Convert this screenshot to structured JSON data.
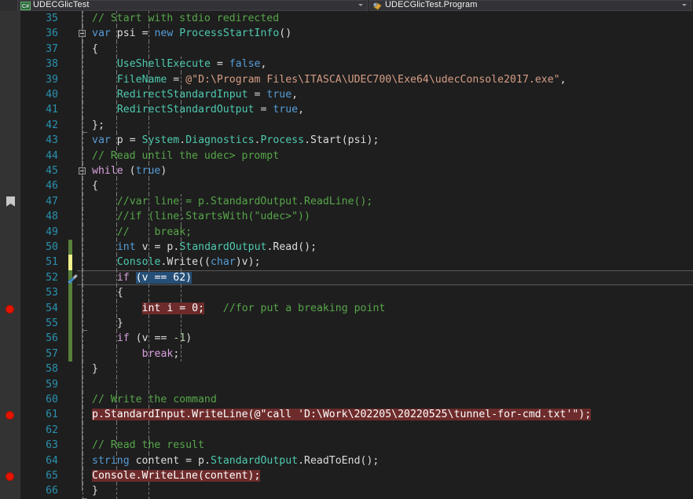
{
  "nav_bar": {
    "project_combo": {
      "icon": "csharp-file-icon",
      "label": "UDECGlicTest",
      "arrow": "chevron-down-icon"
    },
    "member_combo": {
      "icon": "class-member-icon",
      "label": "UDECGlicTest.Program",
      "arrow": "chevron-down-icon"
    }
  },
  "editor": {
    "language": "csharp",
    "theme": "dark",
    "first_line": 35,
    "last_line": 66,
    "current_line": 52,
    "selection_text": "(v == 62)",
    "breakpoint_lines": [
      54,
      61,
      65
    ],
    "bookmark_lines": [
      47
    ],
    "tool_icon_line": 52,
    "changed_saved_lines": [
      50,
      52,
      53,
      54,
      55,
      56,
      57
    ],
    "changed_unsaved_lines": [
      51
    ],
    "lines": [
      {
        "n": 35,
        "text": "// Start with stdio redirected"
      },
      {
        "n": 36,
        "text": "var psi = new ProcessStartInfo()"
      },
      {
        "n": 37,
        "text": "{"
      },
      {
        "n": 38,
        "text": "    UseShellExecute = false,"
      },
      {
        "n": 39,
        "text": "    FileName = @\"D:\\Program Files\\ITASCA\\UDEC700\\Exe64\\udecConsole2017.exe\","
      },
      {
        "n": 40,
        "text": "    RedirectStandardInput = true,"
      },
      {
        "n": 41,
        "text": "    RedirectStandardOutput = true,"
      },
      {
        "n": 42,
        "text": "};"
      },
      {
        "n": 43,
        "text": "var p = System.Diagnostics.Process.Start(psi);"
      },
      {
        "n": 44,
        "text": "// Read until the udec> prompt"
      },
      {
        "n": 45,
        "text": "while (true)"
      },
      {
        "n": 46,
        "text": "{"
      },
      {
        "n": 47,
        "text": "    //var line = p.StandardOutput.ReadLine();"
      },
      {
        "n": 48,
        "text": "    //if (line.StartsWith(\"udec>\"))"
      },
      {
        "n": 49,
        "text": "    //    break;"
      },
      {
        "n": 50,
        "text": "    int v = p.StandardOutput.Read();"
      },
      {
        "n": 51,
        "text": "    Console.Write((char)v);"
      },
      {
        "n": 52,
        "text": "    if (v == 62)"
      },
      {
        "n": 53,
        "text": "    {"
      },
      {
        "n": 54,
        "text": "        int i = 0;   //for put a breaking point"
      },
      {
        "n": 55,
        "text": "    }"
      },
      {
        "n": 56,
        "text": "    if (v == -1)"
      },
      {
        "n": 57,
        "text": "        break;"
      },
      {
        "n": 58,
        "text": "}"
      },
      {
        "n": 59,
        "text": ""
      },
      {
        "n": 60,
        "text": "// Write the command"
      },
      {
        "n": 61,
        "text": "p.StandardInput.WriteLine(@\"call 'D:\\Work\\202205\\20220525\\tunnel-for-cmd.txt'\");"
      },
      {
        "n": 62,
        "text": ""
      },
      {
        "n": 63,
        "text": "// Read the result"
      },
      {
        "n": 64,
        "text": "string content = p.StandardOutput.ReadToEnd();"
      },
      {
        "n": 65,
        "text": "Console.WriteLine(content);"
      },
      {
        "n": 66,
        "text": "}"
      }
    ]
  },
  "colors": {
    "background": "#1e1e1e",
    "gutter": "#333333",
    "line_number": "#2b91af",
    "comment": "#57a64a",
    "keyword": "#569cd6",
    "control_keyword": "#d8a0df",
    "string": "#d69d85",
    "number": "#b5cea8",
    "type": "#4ec9b0",
    "plain": "#dcdcdc",
    "selection": "#264f78",
    "breakpoint_highlight": "#6e2b2b",
    "breakpoint_glyph": "#e51400",
    "change_saved": "#57803a",
    "change_unsaved": "#f0f08c"
  }
}
